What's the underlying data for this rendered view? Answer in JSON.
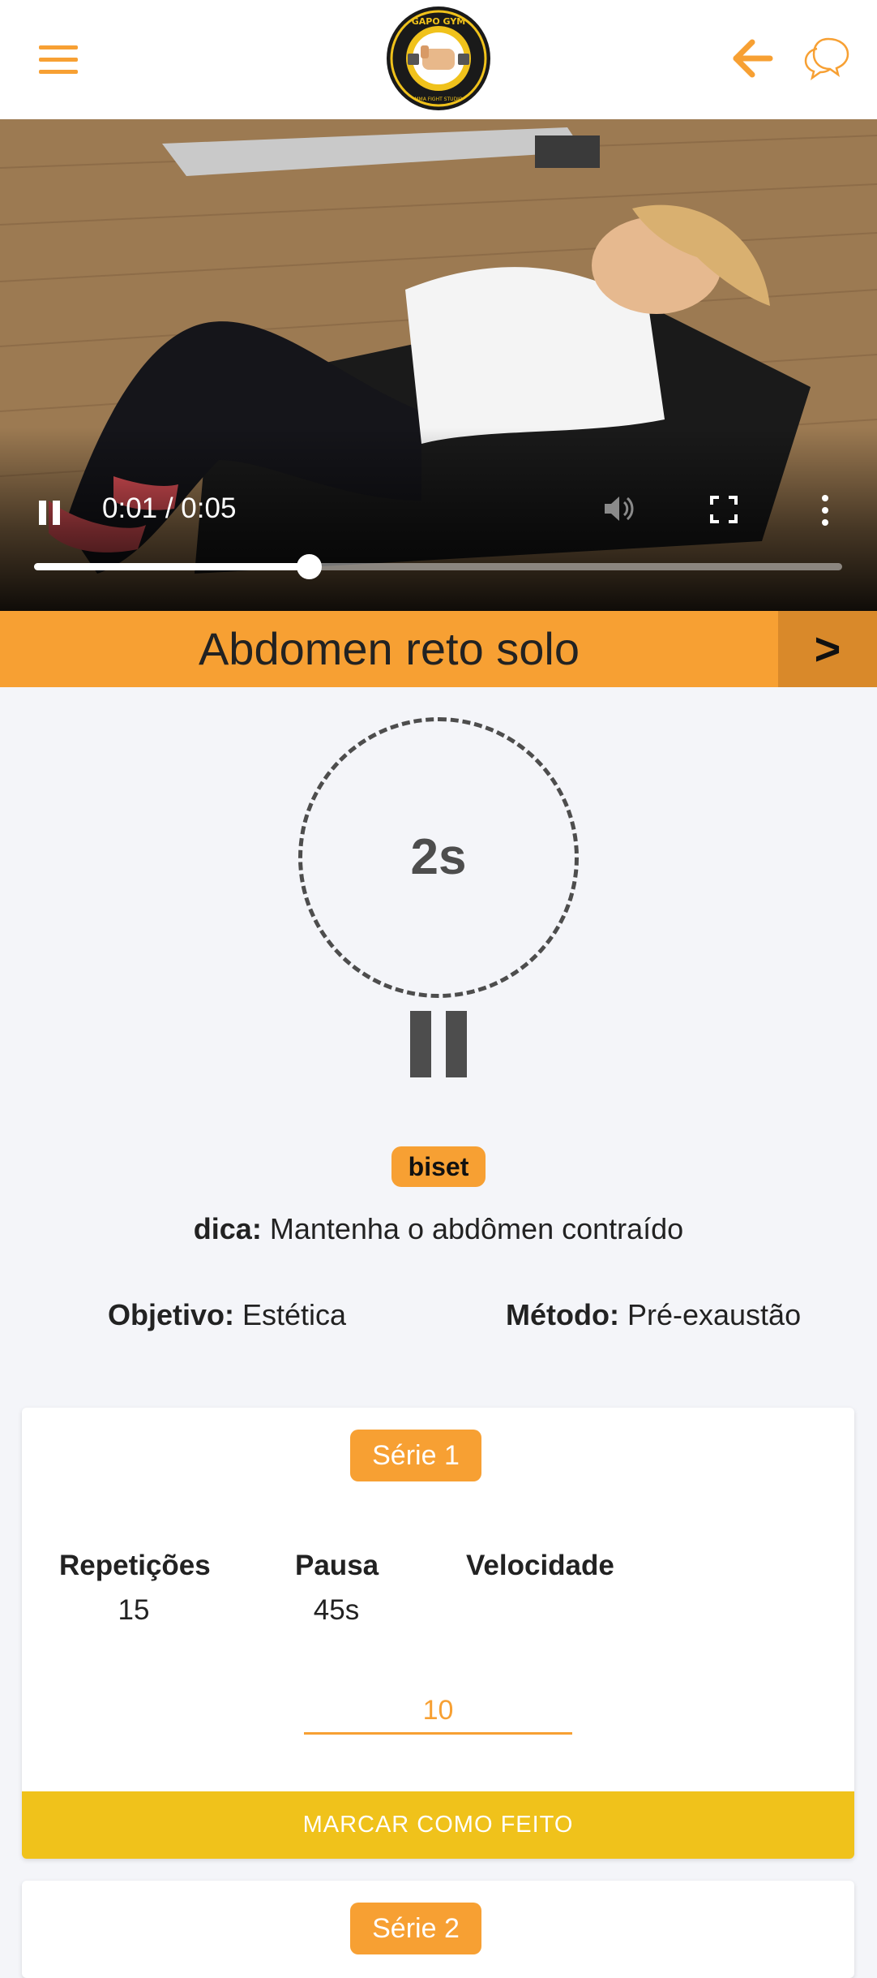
{
  "header": {
    "menu_icon": "hamburger-menu-icon",
    "logo_text_top": "GAPO GYM",
    "logo_text_bottom": "MMA FIGHT STUDIO",
    "back_icon": "arrow-left-icon",
    "chat_icon": "chat-bubbles-icon",
    "accent_color": "#f7a033"
  },
  "video": {
    "time": "0:01 / 0:05",
    "progress_fraction": 0.34,
    "pause_icon": "pause-icon",
    "volume_icon": "volume-icon",
    "fullscreen_icon": "fullscreen-icon",
    "more_icon": "more-vertical-icon"
  },
  "exercise": {
    "title": "Abdomen reto solo",
    "next_label": ">"
  },
  "timer": {
    "value": "2s",
    "pause_icon": "pause-icon"
  },
  "badge": "biset",
  "tip": {
    "label": "dica:",
    "text": " Mantenha o abdômen contraído"
  },
  "goal": {
    "label": "Objetivo:",
    "value": " Estética"
  },
  "method": {
    "label": "Método:",
    "value": " Pré-exaustão"
  },
  "series": [
    {
      "label": "Série 1",
      "reps_label": "Repetições",
      "reps_value": "15",
      "rest_label": "Pausa",
      "rest_value": "45s",
      "speed_label": "Velocidade",
      "speed_input_value": "10",
      "done_label": "MARCAR COMO FEITO"
    },
    {
      "label": "Série 2"
    }
  ]
}
